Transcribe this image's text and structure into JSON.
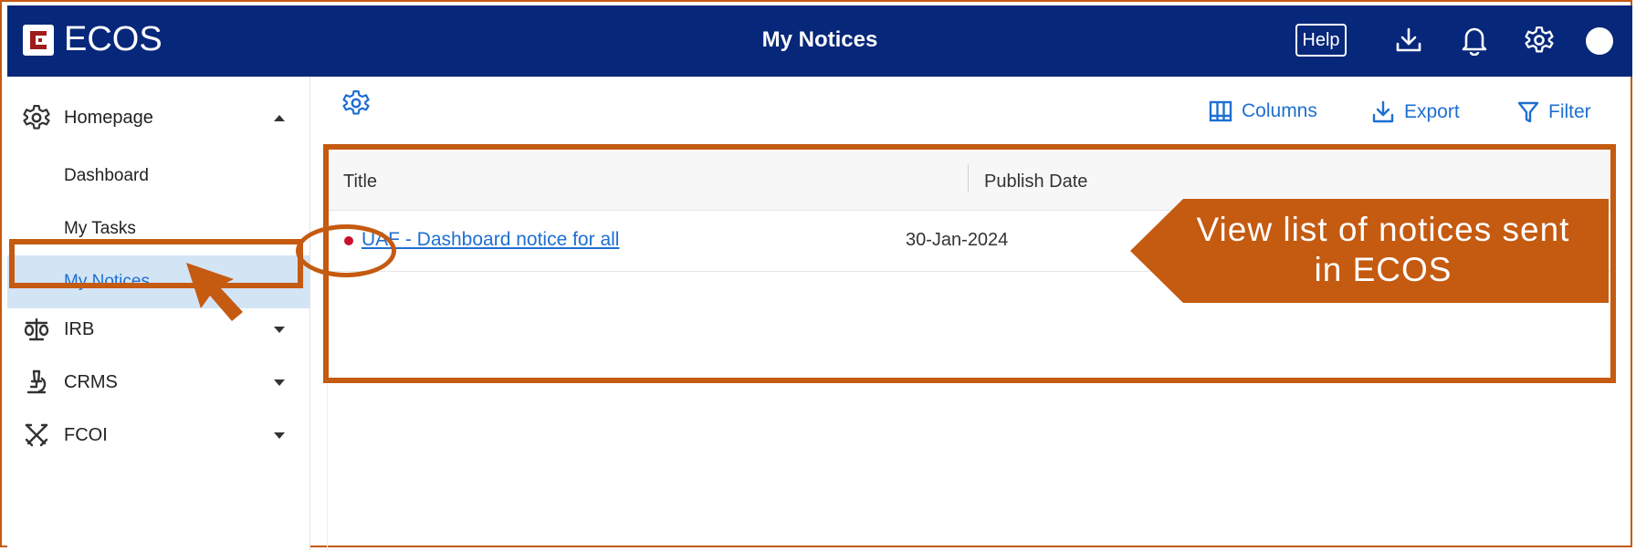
{
  "header": {
    "brand": "ECOS",
    "title": "My Notices",
    "help_label": "Help",
    "icons": [
      "download-icon",
      "bell-icon",
      "gear-icon",
      "avatar"
    ]
  },
  "sidebar": {
    "items": [
      {
        "label": "Homepage",
        "icon": "gear-icon",
        "expanded": true
      },
      {
        "label": "Dashboard"
      },
      {
        "label": "My Tasks"
      },
      {
        "label": "My Notices",
        "active": true
      },
      {
        "label": "IRB",
        "icon": "scales-icon"
      },
      {
        "label": "CRMS",
        "icon": "microscope-icon"
      },
      {
        "label": "FCOI",
        "icon": "crossed-swords-icon"
      }
    ]
  },
  "toolbar": {
    "columns_label": "Columns",
    "export_label": "Export",
    "filter_label": "Filter"
  },
  "table": {
    "columns": [
      "Title",
      "Publish Date"
    ],
    "rows": [
      {
        "title": "UAF - Dashboard notice for all",
        "publish_date": "30-Jan-2024",
        "unread": true
      }
    ]
  },
  "annotation": {
    "text": "View list of notices sent in ECOS",
    "color": "#c55a11"
  },
  "colors": {
    "header_bg": "#07277a",
    "accent": "#1f6fd1",
    "active_bg": "#d3e4f5",
    "highlight": "#c55a11"
  }
}
